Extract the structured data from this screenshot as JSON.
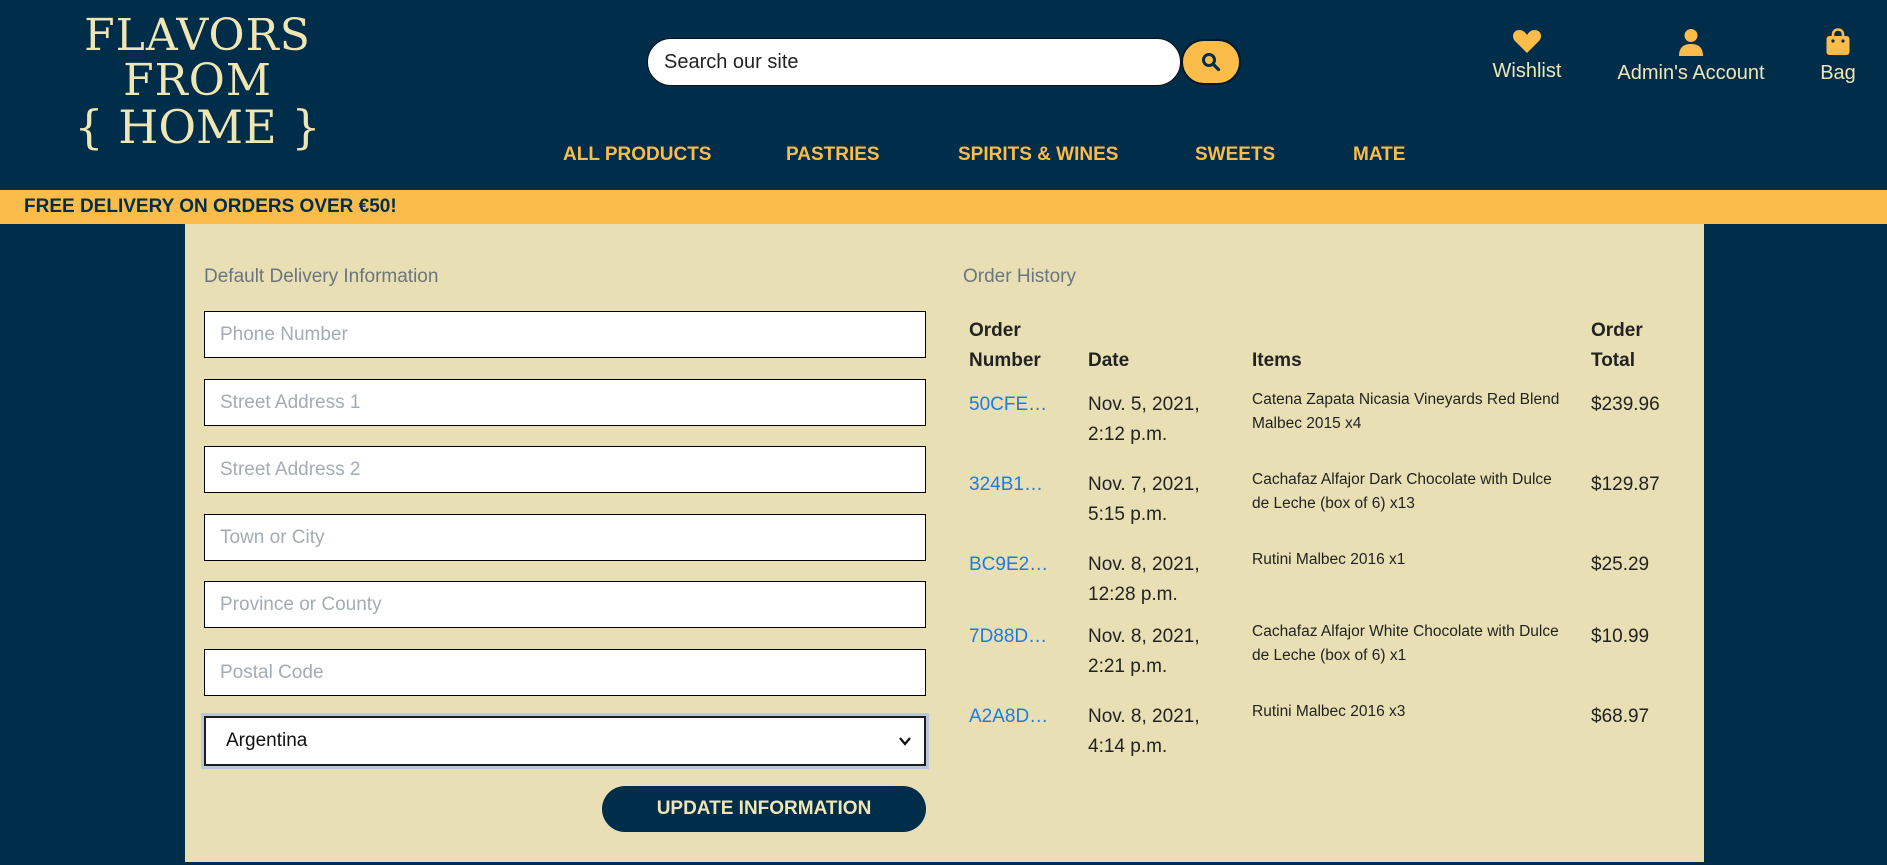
{
  "header": {
    "logo_line1": "FLAVORS FROM",
    "logo_line2": "{ HOME }",
    "search_placeholder": "Search our site",
    "wishlist_label": "Wishlist",
    "account_label": "Admin's Account",
    "bag_label": "Bag"
  },
  "nav": {
    "items": [
      "ALL PRODUCTS",
      "PASTRIES",
      "SPIRITS & WINES",
      "SWEETS",
      "MATE"
    ]
  },
  "banner": {
    "text": "FREE DELIVERY ON ORDERS OVER €50!"
  },
  "delivery": {
    "title": "Default Delivery Information",
    "phone_placeholder": "Phone Number",
    "street1_placeholder": "Street Address 1",
    "street2_placeholder": "Street Address 2",
    "town_placeholder": "Town or City",
    "county_placeholder": "Province or County",
    "postcode_placeholder": "Postal Code",
    "country_value": "Argentina",
    "update_label": "UPDATE INFORMATION"
  },
  "history": {
    "title": "Order History",
    "columns": {
      "number_l1": "Order",
      "number_l2": "Number",
      "date": "Date",
      "items": "Items",
      "total_l1": "Order",
      "total_l2": "Total"
    },
    "rows": [
      {
        "number": "50CFE…",
        "date_l1": "Nov. 5, 2021,",
        "date_l2": "2:12 p.m.",
        "items_l1": "Catena Zapata Nicasia Vineyards Red Blend",
        "items_l2": "Malbec 2015 x4",
        "total": "$239.96"
      },
      {
        "number": "324B1…",
        "date_l1": "Nov. 7, 2021,",
        "date_l2": "5:15 p.m.",
        "items_l1": "Cachafaz Alfajor Dark Chocolate with Dulce",
        "items_l2": "de Leche (box of 6) x13",
        "total": "$129.87"
      },
      {
        "number": "BC9E2…",
        "date_l1": "Nov. 8, 2021,",
        "date_l2": "12:28 p.m.",
        "items_l1": "Rutini Malbec 2016 x1",
        "items_l2": "",
        "total": "$25.29"
      },
      {
        "number": "7D88D…",
        "date_l1": "Nov. 8, 2021,",
        "date_l2": "2:21 p.m.",
        "items_l1": "Cachafaz Alfajor White Chocolate with Dulce",
        "items_l2": "de Leche (box of 6) x1",
        "total": "$10.99"
      },
      {
        "number": "A2A8D…",
        "date_l1": "Nov. 8, 2021,",
        "date_l2": "4:14 p.m.",
        "items_l1": "Rutini Malbec 2016 x3",
        "items_l2": "",
        "total": "$68.97"
      }
    ]
  },
  "colors": {
    "navy": "#002d4a",
    "gold": "#fcbc49",
    "cream": "#f0e6b4",
    "panel": "#e8e0b4",
    "link": "#1e7be6"
  }
}
